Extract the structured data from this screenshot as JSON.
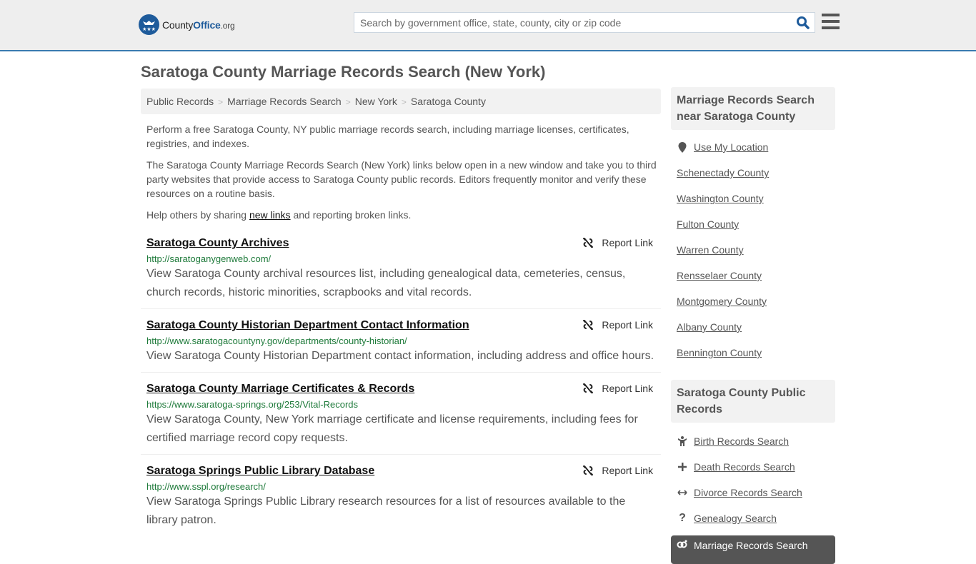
{
  "header": {
    "logo": {
      "name_part1": "County",
      "name_part2": "Office",
      "name_part3": ".org"
    },
    "search": {
      "placeholder": "Search by government office, state, county, city or zip code",
      "value": ""
    }
  },
  "page_title": "Saratoga County Marriage Records Search (New York)",
  "breadcrumb": [
    "Public Records",
    "Marriage Records Search",
    "New York",
    "Saratoga County"
  ],
  "intro": {
    "p1": "Perform a free Saratoga County, NY public marriage records search, including marriage licenses, certificates, registries, and indexes.",
    "p2": "The Saratoga County Marriage Records Search (New York) links below open in a new window and take you to third party websites that provide access to Saratoga County public records. Editors frequently monitor and verify these resources on a routine basis.",
    "p3_before": "Help others by sharing ",
    "p3_link": "new links",
    "p3_after": " and reporting broken links."
  },
  "report_label": "Report Link",
  "results": [
    {
      "title": "Saratoga County Archives",
      "url": "http://saratoganygenweb.com/",
      "description": "View Saratoga County archival resources list, including genealogical data, cemeteries, census, church records, historic minorities, scrapbooks and vital records."
    },
    {
      "title": "Saratoga County Historian Department Contact Information",
      "url": "http://www.saratogacountyny.gov/departments/county-historian/",
      "description": "View Saratoga County Historian Department contact information, including address and office hours."
    },
    {
      "title": "Saratoga County Marriage Certificates & Records",
      "url": "https://www.saratoga-springs.org/253/Vital-Records",
      "description": "View Saratoga County, New York marriage certificate and license requirements, including fees for certified marriage record copy requests."
    },
    {
      "title": "Saratoga Springs Public Library Database",
      "url": "http://www.sspl.org/research/",
      "description": "View Saratoga Springs Public Library research resources for a list of resources available to the library patron."
    }
  ],
  "sidebar": {
    "nearby": {
      "heading": "Marriage Records Search near Saratoga County",
      "location_label": "Use My Location",
      "counties": [
        "Schenectady County",
        "Washington County",
        "Fulton County",
        "Warren County",
        "Rensselaer County",
        "Montgomery County",
        "Albany County",
        "Bennington County"
      ]
    },
    "public_records": {
      "heading": "Saratoga County Public Records",
      "items": [
        {
          "label": "Birth Records Search",
          "icon": "child-icon"
        },
        {
          "label": "Death Records Search",
          "icon": "plus-icon"
        },
        {
          "label": "Divorce Records Search",
          "icon": "arrows-horizontal-icon"
        },
        {
          "label": "Genealogy Search",
          "icon": "question-icon"
        }
      ],
      "active": {
        "label": "Marriage Records Search",
        "icon": "rings-icon"
      }
    }
  },
  "colors": {
    "header_bg": "#eeeeee",
    "header_border": "#3a7bb0",
    "brand_blue": "#1e5b9b",
    "url_green": "#1e7a3a",
    "active_bg": "#555555"
  }
}
